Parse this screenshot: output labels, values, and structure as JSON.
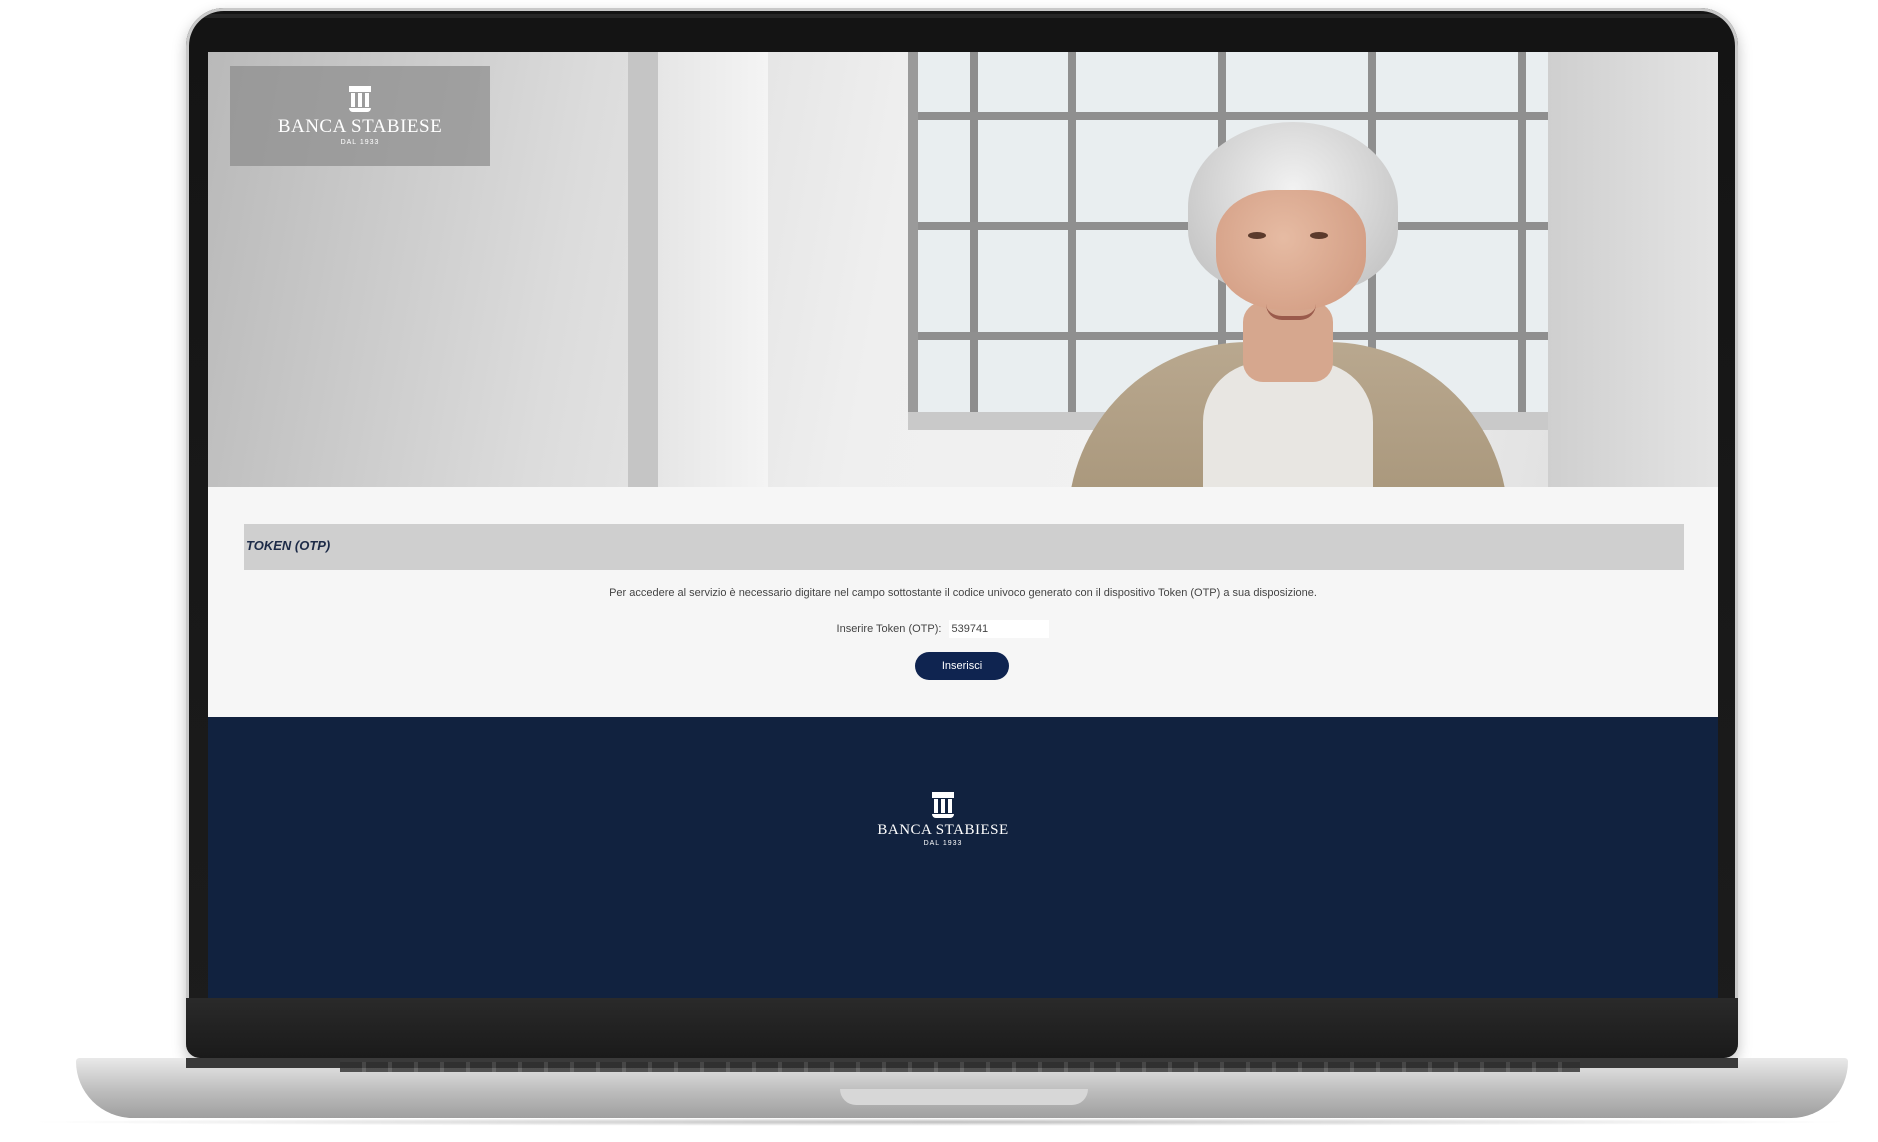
{
  "brand": {
    "name": "BANCA STABIESE",
    "since": "DAL 1933"
  },
  "token_section": {
    "title": "TOKEN (OTP)",
    "info_text": "Per accedere al servizio è necessario digitare nel campo sottostante il codice univoco generato con il dispositivo Token (OTP) a sua disposizione.",
    "input_label": "Inserire Token (OTP):",
    "input_value": "539741",
    "submit_label": "Inserisci"
  },
  "colors": {
    "primary": "#0f2450",
    "footer": "#11223f",
    "token_bar": "#cfcfcf"
  },
  "icons": {
    "logo": "bank-building-icon"
  }
}
